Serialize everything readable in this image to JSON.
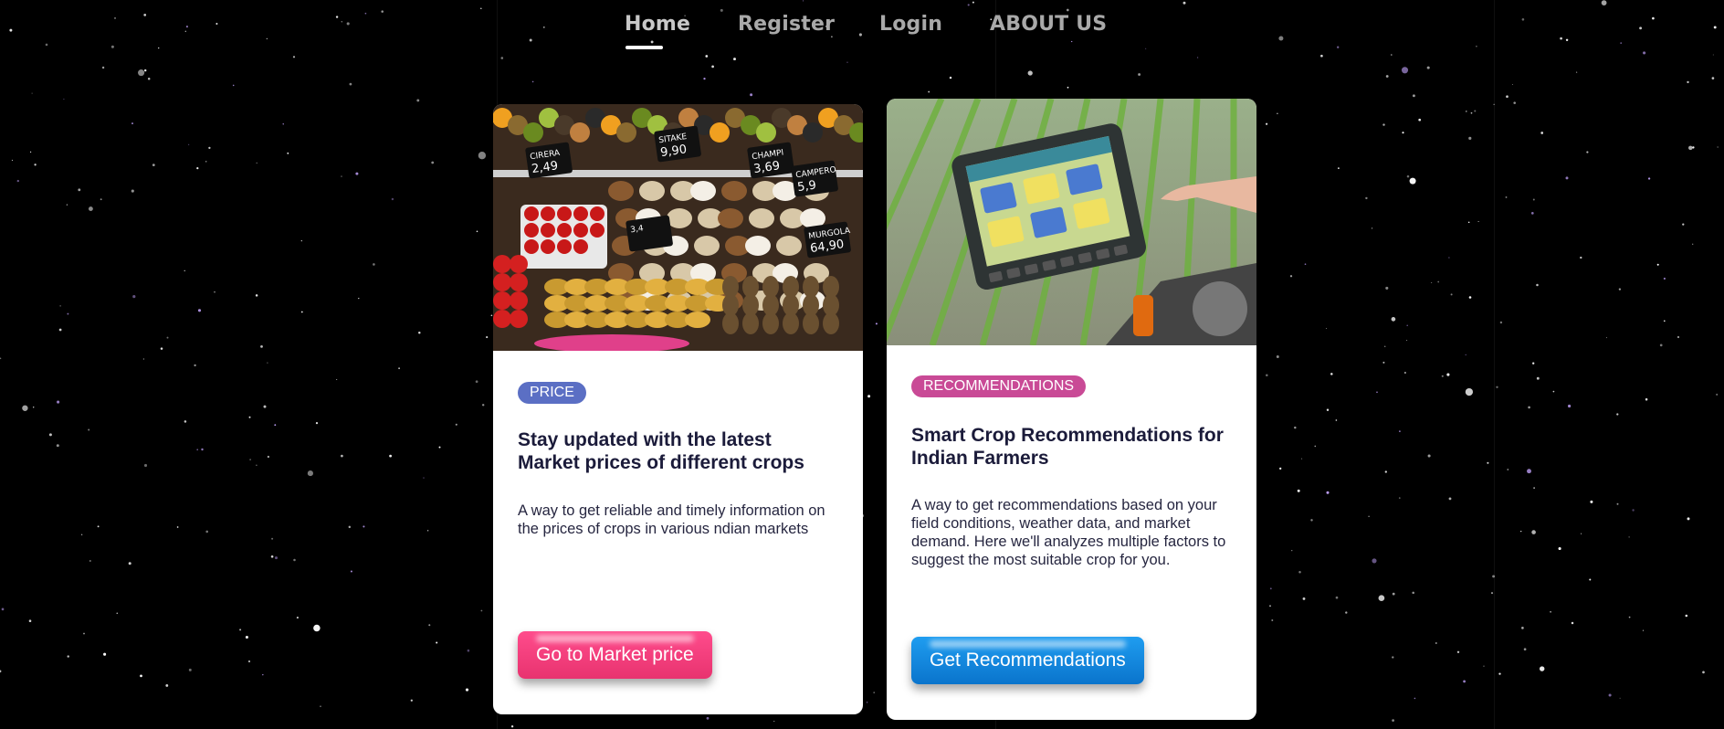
{
  "nav": {
    "items": [
      {
        "label": "Home",
        "active": true
      },
      {
        "label": "Register",
        "active": false
      },
      {
        "label": "Login",
        "active": false
      },
      {
        "label": "ABOUT US",
        "active": false
      }
    ]
  },
  "cards": [
    {
      "image_subject": "market stall with fruits, mushrooms and price tags",
      "badge": "PRICE",
      "badge_color": "#5b6fc4",
      "title": "Stay updated with the latest Market prices of different crops",
      "description": "A way to get reliable and timely information on the prices of crops in various ndian markets",
      "button_label": "Go to Market price",
      "button_color": "#f23c7b",
      "price_tags": [
        "CIRERA 2,49",
        "SITAKE 9,90",
        "CHAMPI 3,69",
        "CAMPERO 5,9",
        "MURGOLA 64,90",
        "3,4"
      ]
    },
    {
      "image_subject": "tractor touchscreen in crop field",
      "badge": "RECOMMENDATIONS",
      "badge_color": "#c94a96",
      "title": "Smart Crop Recommendations for Indian Farmers",
      "description": "A way to get recommendations based on your field conditions, weather data, and market demand. Here we'll analyzes multiple factors to suggest the most suitable crop for you.",
      "button_label": "Get Recommendations",
      "button_color": "#1088de"
    }
  ],
  "colors": {
    "background": "#000000",
    "nav_text": "#a9a9a9",
    "card_bg": "#ffffff",
    "title_text": "#1b1b3a"
  }
}
